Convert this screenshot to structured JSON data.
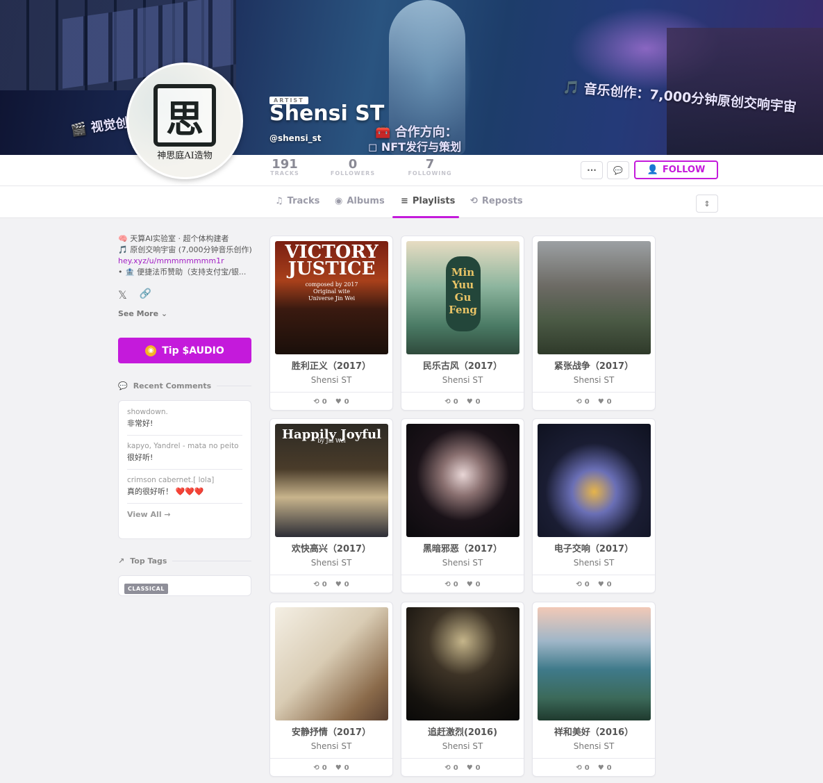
{
  "banner": {
    "caption_left": "🎬 视觉创",
    "caption_right": "🎵 音乐创作：7,000分钟原创交响宇宙",
    "caption_center1": "🧰 合作方向：",
    "caption_center2": "◻ NFT发行与策划"
  },
  "profile": {
    "avatar_glyph": "思",
    "avatar_seal": "神思庭AI造物",
    "badge": "ARTIST",
    "name": "Shensi ST",
    "handle": "@shensi_st"
  },
  "stats": [
    {
      "value": "191",
      "label": "TRACKS"
    },
    {
      "value": "0",
      "label": "FOLLOWERS"
    },
    {
      "value": "7",
      "label": "FOLLOWING"
    }
  ],
  "actions": {
    "more": "···",
    "message": "💬",
    "follow": "FOLLOW"
  },
  "tabs": [
    {
      "label": "Tracks",
      "icon": "♫"
    },
    {
      "label": "Albums",
      "icon": "◉"
    },
    {
      "label": "Playlists",
      "icon": "≡"
    },
    {
      "label": "Reposts",
      "icon": "⟲"
    }
  ],
  "sort_icon": "⇕",
  "bio": {
    "line1": "🧠 天算AI实验室 · 超个体构建者",
    "line2": "🎵 原创交响宇宙 (7,000分钟音乐创作)",
    "link": "hey.xyz/u/mmmmmmmm1r",
    "line4": "• 🏦 便捷法币赞助（支持支付宝/银..."
  },
  "social": {
    "x_icon": "𝕏",
    "link_icon": "🔗"
  },
  "see_more": "See More ⌄",
  "tip": {
    "label": "Tip $AUDIO",
    "coin": "◉"
  },
  "recent_comments": {
    "title": "Recent Comments",
    "items": [
      {
        "who": "showdown.",
        "text": "非常好!"
      },
      {
        "who": "kapyo, Yandrel - mata no peito",
        "text": "很好听!"
      },
      {
        "who": "crimson cabernet.[ lola]",
        "text": "真的很好听！ ❤️❤️❤️"
      }
    ],
    "view_all": "View All →"
  },
  "top_tags": {
    "title": "Top Tags",
    "tags": [
      "CLASSICAL"
    ]
  },
  "playlists": [
    {
      "title": "胜利正义（2017）",
      "artist": "Shensi ST",
      "reposts": "0",
      "likes": "0",
      "art_text": "VICTORY\nJUSTICE",
      "art_sub": "composed by 2017 Original wite Universe Jin Wei"
    },
    {
      "title": "民乐古风（2017）",
      "artist": "Shensi ST",
      "reposts": "0",
      "likes": "0",
      "art_text": "Min Yuu Gu Feng",
      "art_sub": ""
    },
    {
      "title": "紧张战争（2017）",
      "artist": "Shensi ST",
      "reposts": "0",
      "likes": "0",
      "art_text": "",
      "art_sub": ""
    },
    {
      "title": "欢快高兴（2017）",
      "artist": "Shensi ST",
      "reposts": "0",
      "likes": "0",
      "art_text": "Happily Joyful",
      "art_sub": "by Jin Wei"
    },
    {
      "title": "黑暗邪恶（2017）",
      "artist": "Shensi ST",
      "reposts": "0",
      "likes": "0",
      "art_text": "",
      "art_sub": ""
    },
    {
      "title": "电子交响（2017）",
      "artist": "Shensi ST",
      "reposts": "0",
      "likes": "0",
      "art_text": "",
      "art_sub": ""
    },
    {
      "title": "安静抒情（2017）",
      "artist": "Shensi ST",
      "reposts": "0",
      "likes": "0",
      "art_text": "",
      "art_sub": ""
    },
    {
      "title": "追赶激烈(2016)",
      "artist": "Shensi ST",
      "reposts": "0",
      "likes": "0",
      "art_text": "",
      "art_sub": ""
    },
    {
      "title": "祥和美好（2016）",
      "artist": "Shensi ST",
      "reposts": "0",
      "likes": "0",
      "art_text": "",
      "art_sub": ""
    }
  ],
  "colors": {
    "accent": "#c41adb",
    "link": "#a21fc4"
  }
}
